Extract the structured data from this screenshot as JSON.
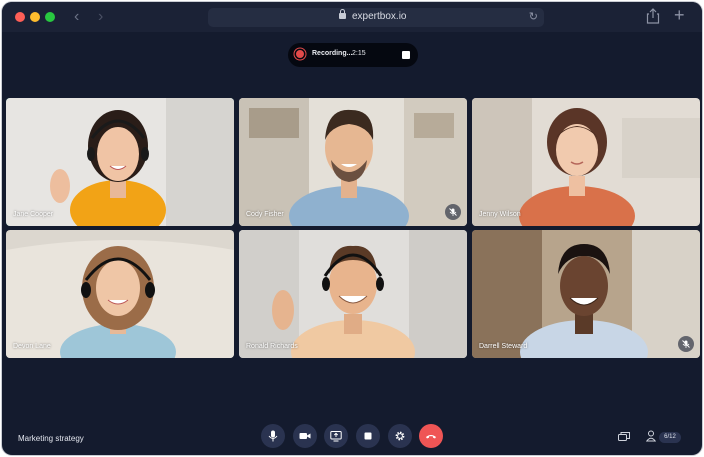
{
  "browser": {
    "url": "expertbox.io",
    "icons": [
      "back-arrow-icon",
      "forward-arrow-icon",
      "lock-icon",
      "reload-icon",
      "share-icon",
      "new-tab-icon"
    ]
  },
  "recording": {
    "label": "Recording...",
    "time": "2:15"
  },
  "participants": [
    {
      "name": "Jane Cooper",
      "muted": false,
      "active": true
    },
    {
      "name": "Cody Fisher",
      "muted": true,
      "active": false
    },
    {
      "name": "Jenny Wilson",
      "muted": false,
      "active": false
    },
    {
      "name": "Devon Lane",
      "muted": false,
      "active": false
    },
    {
      "name": "Ronald Richards",
      "muted": false,
      "active": false
    },
    {
      "name": "Darrell Steward",
      "muted": true,
      "active": false
    }
  ],
  "footer": {
    "meeting_title": "Marketing strategy",
    "controls": [
      "microphone-icon",
      "camera-icon",
      "screen-share-icon",
      "stop-icon",
      "settings-icon",
      "end-call-icon"
    ],
    "participant_count": "6/12"
  },
  "colors": {
    "background": "#141b2e",
    "active_border": "#3ec2a4",
    "end_call": "#ef5555",
    "record": "#e24a4a"
  }
}
